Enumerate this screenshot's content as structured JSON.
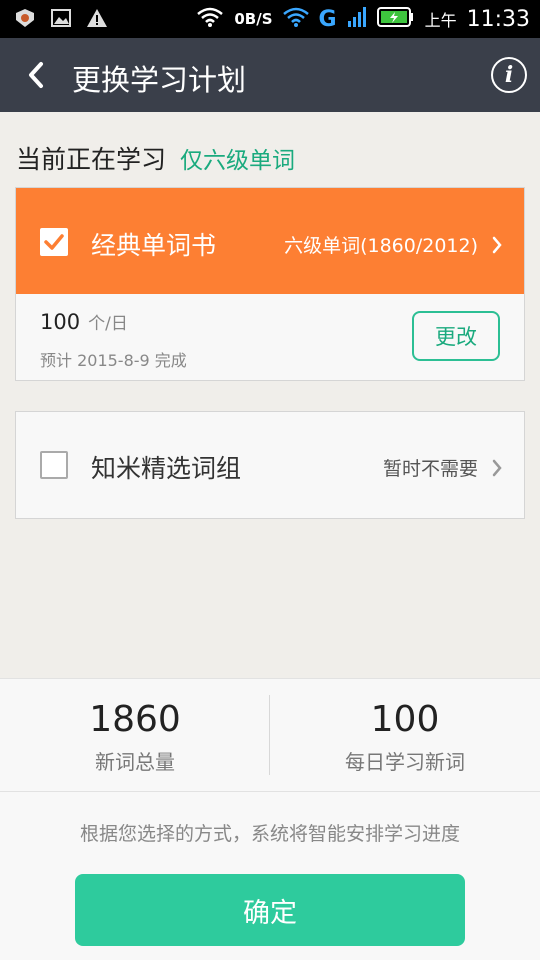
{
  "status_bar": {
    "net_speed": "0B/S",
    "network_type": "G",
    "ampm": "上午",
    "time": "11:33",
    "icons": [
      "app-icon",
      "image-icon",
      "warning-icon",
      "wifi-icon",
      "signal-icon",
      "battery-charging-icon"
    ]
  },
  "header": {
    "title": "更换学习计划",
    "back_icon": "chevron-left-icon",
    "info_icon": "info-icon",
    "info_glyph": "i"
  },
  "current": {
    "label": "当前正在学习",
    "value": "仅六级单词"
  },
  "plans": [
    {
      "name": "经典单词书",
      "detail": "六级单词(1860/2012)",
      "checked": true,
      "daily_count": "100",
      "daily_unit": "个/日",
      "estimate": "预计 2015-8-9 完成",
      "change_label": "更改"
    },
    {
      "name": "知米精选词组",
      "detail": "暂时不需要",
      "checked": false
    }
  ],
  "stats": {
    "total_words": "1860",
    "total_words_label": "新词总量",
    "daily_new": "100",
    "daily_new_label": "每日学习新词"
  },
  "hint": "根据您选择的方式，系统将智能安排学习进度",
  "confirm_label": "确定",
  "colors": {
    "header_bg": "#3a3f4a",
    "accent_orange": "#fd7f33",
    "accent_green": "#2ecb9d",
    "text_green": "#1aaa7e",
    "page_bg": "#f0eeea"
  }
}
